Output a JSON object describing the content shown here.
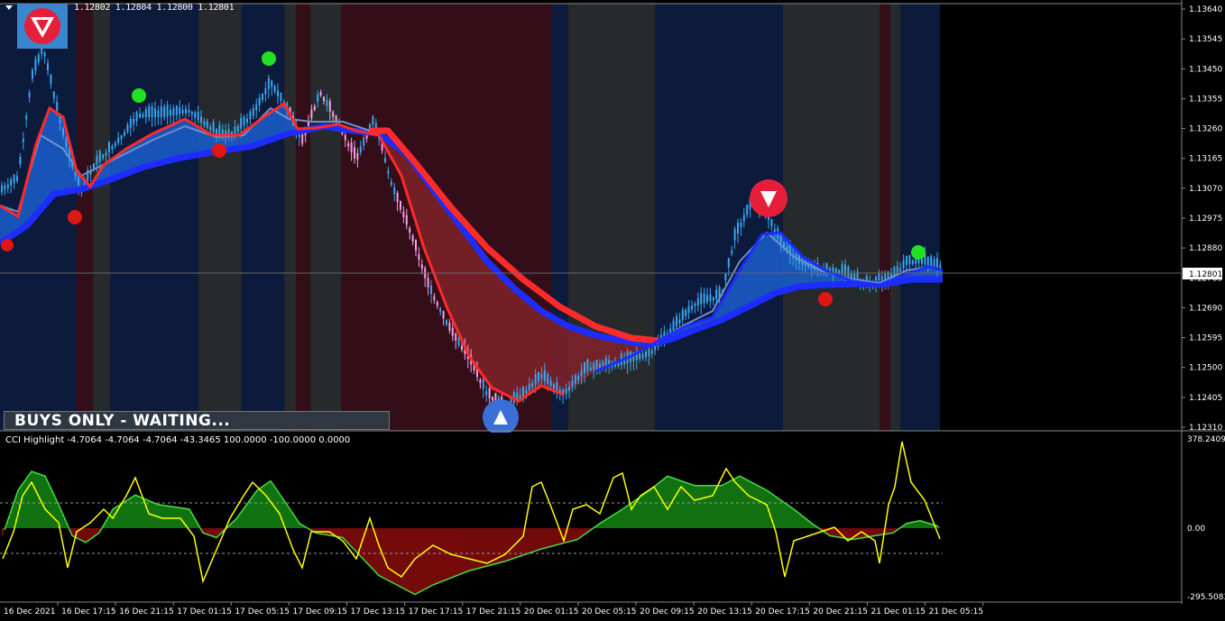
{
  "header": {
    "ohlc": "1.12802 1.12804 1.12800 1.12801"
  },
  "banner": {
    "label": "BUYS ONLY - WAITING..."
  },
  "price_axis": {
    "ticks": [
      "1.13640",
      "1.13545",
      "1.13450",
      "1.13355",
      "1.13260",
      "1.13165",
      "1.13070",
      "1.12975",
      "1.12880",
      "1.12785",
      "1.12690",
      "1.12595",
      "1.12500",
      "1.12405",
      "1.12310"
    ],
    "current_price": "1.12801"
  },
  "indicator": {
    "title": "CCI Highlight -4.7064 -4.7064 -4.7064 -43.3465 100.0000 -100.0000 0.0000",
    "ticks": [
      "378.2409",
      "0.00",
      "-295.5083"
    ]
  },
  "time_axis": {
    "labels": [
      "16 Dec 2021",
      "16 Dec 17:15",
      "16 Dec 21:15",
      "17 Dec 01:15",
      "17 Dec 05:15",
      "17 Dec 09:15",
      "17 Dec 13:15",
      "17 Dec 17:15",
      "17 Dec 21:15",
      "20 Dec 01:15",
      "20 Dec 05:15",
      "20 Dec 09:15",
      "20 Dec 13:15",
      "20 Dec 17:15",
      "20 Dec 21:15",
      "21 Dec 01:15",
      "21 Dec 05:15"
    ]
  },
  "colors": {
    "bull_zone": "#0c1a3c",
    "bear_zone": "#330e19",
    "neutral_zone": "#262a2d",
    "fast_ema": "#ff2a2a",
    "slow_ema": "#1d2cff",
    "cloud_bull": "#1a5bc4",
    "cloud_bear": "#7b2128",
    "candle_up": "#3aa6ef",
    "candle_down": "#f4a0e0",
    "cci": "#ffff00",
    "hist_pos": "#1dbd1d",
    "hist_neg": "#c01010"
  },
  "chart_data": {
    "type": "line",
    "title": "",
    "ylim": [
      1.1231,
      1.1364
    ],
    "x": [
      "16 Dec 2021",
      "16 Dec 17:15",
      "16 Dec 21:15",
      "17 Dec 01:15",
      "17 Dec 05:15",
      "17 Dec 09:15",
      "17 Dec 13:15",
      "17 Dec 17:15",
      "17 Dec 21:15",
      "20 Dec 01:15",
      "20 Dec 05:15",
      "20 Dec 09:15",
      "20 Dec 13:15",
      "20 Dec 17:15",
      "20 Dec 21:15",
      "21 Dec 01:15",
      "21 Dec 05:15"
    ],
    "series": [
      {
        "values": [
          1.1305,
          1.1317,
          1.133,
          1.1328,
          1.1332,
          1.1336,
          1.1318,
          1.1278,
          1.124,
          1.125,
          1.1262,
          1.127,
          1.129,
          1.1305,
          1.1279,
          1.1279,
          1.1281
        ]
      },
      {
        "values": [
          1.1295,
          1.131,
          1.132,
          1.1325,
          1.133,
          1.1332,
          1.1325,
          1.13,
          1.127,
          1.1262,
          1.126,
          1.1262,
          1.1272,
          1.1285,
          1.128,
          1.128,
          1.128
        ]
      }
    ]
  },
  "signals": [
    {
      "type": "buy"
    },
    {
      "type": "buy"
    },
    {
      "type": "buy"
    },
    {
      "type": "buy"
    },
    {
      "type": "sell"
    },
    {
      "type": "sell"
    },
    {
      "type": "sell"
    },
    {
      "type": "sell"
    }
  ]
}
